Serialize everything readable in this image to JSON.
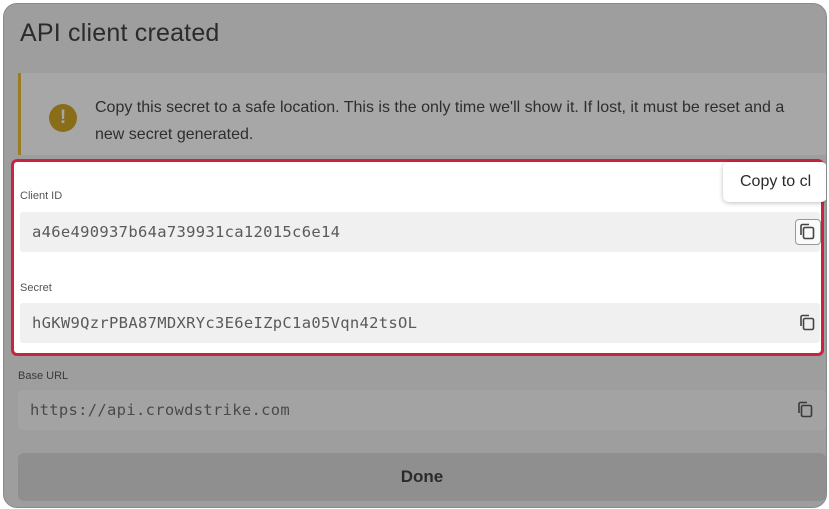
{
  "dialog": {
    "title": "API client created",
    "warning_text": "Copy this secret to a safe location. This is the only time we'll show it. If lost, it must be reset and a new secret generated.",
    "warning_icon": "!",
    "done_label": "Done"
  },
  "tooltip": {
    "text": "Copy to cl"
  },
  "fields": {
    "client_id": {
      "label": "Client ID",
      "value": "a46e490937b64a739931ca12015c6e14"
    },
    "secret": {
      "label": "Secret",
      "value": "hGKW9QzrPBA87MDXRYc3E6eIZpC1a05Vqn42tsOL"
    },
    "base_url": {
      "label": "Base URL",
      "value": "https://api.crowdstrike.com"
    }
  },
  "icons": {
    "warning": "warning-icon",
    "copy": "copy-icon"
  },
  "colors": {
    "highlight_border": "#c8243f",
    "warning_accent": "#9a7c22",
    "overlay": "#9e9e9e"
  }
}
